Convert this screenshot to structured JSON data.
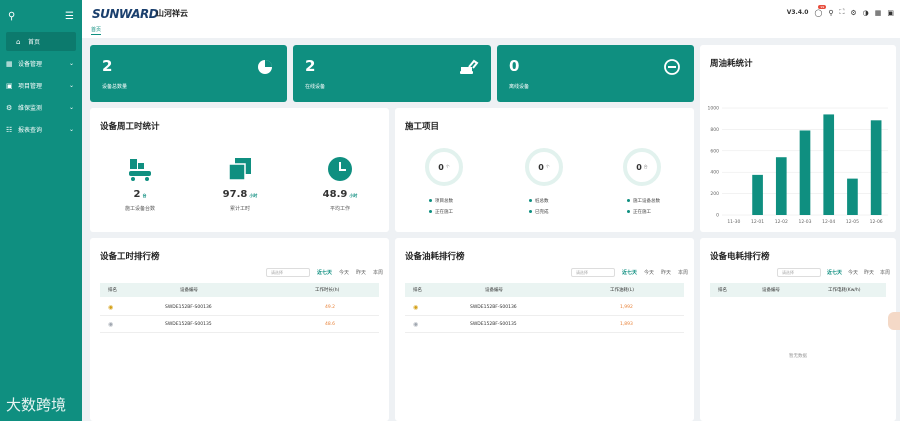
{
  "sidebar": {
    "items": [
      {
        "label": "首页",
        "icon": "home-icon"
      },
      {
        "label": "设备管理",
        "icon": "device-icon"
      },
      {
        "label": "项目管理",
        "icon": "project-icon"
      },
      {
        "label": "维保监测",
        "icon": "maintenance-icon"
      },
      {
        "label": "报表查询",
        "icon": "report-icon"
      }
    ]
  },
  "header": {
    "logo": "SUNWARD",
    "company": "山河祥云",
    "tab": "首页",
    "version": "V3.4.0",
    "notify_count": "99"
  },
  "stats": [
    {
      "value": "2",
      "label": "设备总数量"
    },
    {
      "value": "2",
      "label": "在线设备"
    },
    {
      "value": "0",
      "label": "离线设备"
    }
  ],
  "weekly": {
    "title": "设备周工时统计",
    "items": [
      {
        "value": "2",
        "unit": "台",
        "label": "施工设备台数"
      },
      {
        "value": "97.8",
        "unit": "小时",
        "label": "累计工时"
      },
      {
        "value": "48.9",
        "unit": "小时",
        "label": "平均工作"
      }
    ]
  },
  "projects": {
    "title": "施工项目",
    "rings": [
      {
        "value": "0",
        "unit": "个",
        "legend": [
          "项目总数",
          "正在施工"
        ]
      },
      {
        "value": "0",
        "unit": "个",
        "legend": [
          "桩总数",
          "已完成"
        ]
      },
      {
        "value": "0",
        "unit": "台",
        "legend": [
          "施工设备总数",
          "正在施工"
        ]
      }
    ]
  },
  "fuel_chart": {
    "title": "周油耗统计"
  },
  "chart_data": {
    "type": "bar",
    "title": "周油耗统计",
    "categories": [
      "11-30",
      "12-01",
      "12-02",
      "12-03",
      "12-04",
      "12-05",
      "12-06"
    ],
    "values": [
      0,
      375,
      540,
      790,
      940,
      340,
      885
    ],
    "ylim": [
      0,
      1000
    ],
    "yticks": [
      0,
      200,
      400,
      600,
      800,
      1000
    ],
    "color": "#0f8f80"
  },
  "hours_rank": {
    "title": "设备工时排行榜",
    "date_placeholder": "请选择",
    "filters": [
      "近七天",
      "今天",
      "昨天",
      "本周"
    ],
    "columns": [
      "排名",
      "设备编号",
      "工作时长(h)"
    ],
    "rows": [
      {
        "code": "SWDE152BF-S00136",
        "value": "49.2"
      },
      {
        "code": "SWDE152BF-S00135",
        "value": "48.6"
      }
    ]
  },
  "oil_rank": {
    "title": "设备油耗排行榜",
    "date_placeholder": "请选择",
    "filters": [
      "近七天",
      "今天",
      "昨天",
      "本周"
    ],
    "columns": [
      "排名",
      "设备编号",
      "工作油耗(L)"
    ],
    "rows": [
      {
        "code": "SWDE152BF-S00136",
        "value": "1,992"
      },
      {
        "code": "SWDE152BF-S00135",
        "value": "1,893"
      }
    ]
  },
  "power_rank": {
    "title": "设备电耗排行榜",
    "date_placeholder": "请选择",
    "filters": [
      "近七天",
      "今天",
      "昨天",
      "本周"
    ],
    "columns": [
      "排名",
      "设备编号",
      "工作电耗(Kw/h)"
    ],
    "empty": "暂无数据"
  },
  "watermark": "大数跨境"
}
